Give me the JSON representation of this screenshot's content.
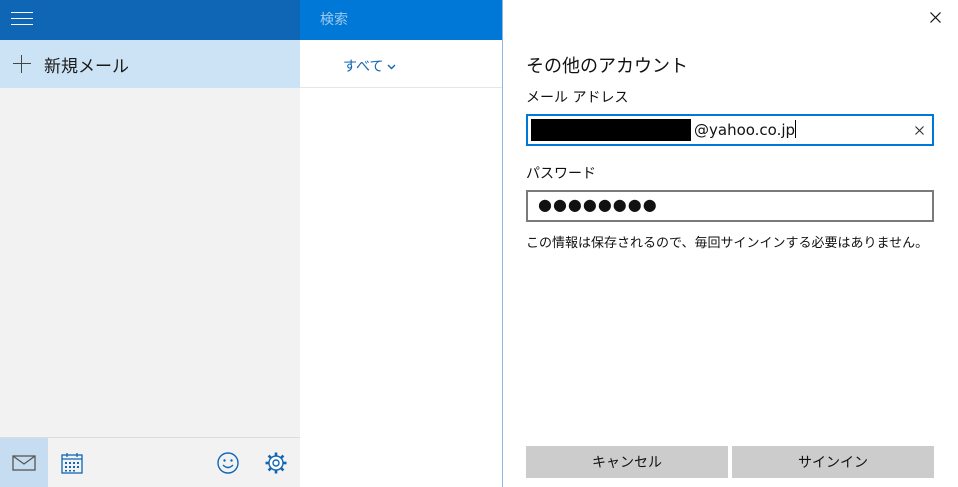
{
  "sidebar": {
    "new_mail_label": "新規メール",
    "accent_color": "#0f66b5",
    "icons": [
      "hamburger-menu-icon",
      "plus-icon",
      "mail-icon",
      "calendar-icon",
      "smiley-icon",
      "gear-icon"
    ]
  },
  "message_list": {
    "search_placeholder": "検索",
    "filter_label": "すべて",
    "header_color": "#0078d7"
  },
  "dialog": {
    "title": "その他のアカウント",
    "email_label": "メール アドレス",
    "email_value": "@yahoo.co.jp",
    "password_label": "パスワード",
    "password_value": "●●●●●●●●",
    "info_text": "この情報は保存されるので、毎回サインインする必要はありません。",
    "cancel_label": "キャンセル",
    "signin_label": "サインイン",
    "button_color": "#cccccc"
  }
}
